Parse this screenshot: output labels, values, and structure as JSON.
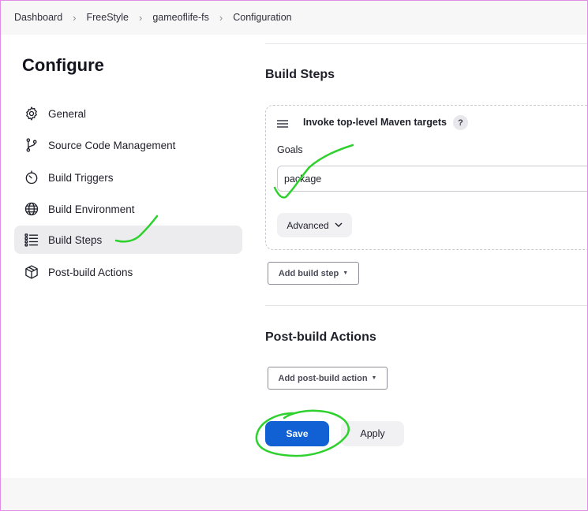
{
  "breadcrumb": {
    "items": [
      "Dashboard",
      "FreeStyle",
      "gameoflife-fs",
      "Configuration"
    ]
  },
  "sidebar": {
    "title": "Configure",
    "items": [
      {
        "label": "General",
        "icon": "gear-icon"
      },
      {
        "label": "Source Code Management",
        "icon": "git-branch-icon"
      },
      {
        "label": "Build Triggers",
        "icon": "timer-icon"
      },
      {
        "label": "Build Environment",
        "icon": "globe-icon"
      },
      {
        "label": "Build Steps",
        "icon": "list-icon",
        "active": true
      },
      {
        "label": "Post-build Actions",
        "icon": "package-icon"
      }
    ]
  },
  "main": {
    "build_steps_title": "Build Steps",
    "step": {
      "title": "Invoke top-level Maven targets",
      "help": "?",
      "goals_label": "Goals",
      "goals_value": "package",
      "advanced_label": "Advanced"
    },
    "add_build_step_label": "Add build step",
    "post_build_title": "Post-build Actions",
    "add_post_build_label": "Add post-build action"
  },
  "actions": {
    "save_label": "Save",
    "apply_label": "Apply"
  },
  "colors": {
    "accent": "#1261d4",
    "annotation": "#2ed12e"
  }
}
